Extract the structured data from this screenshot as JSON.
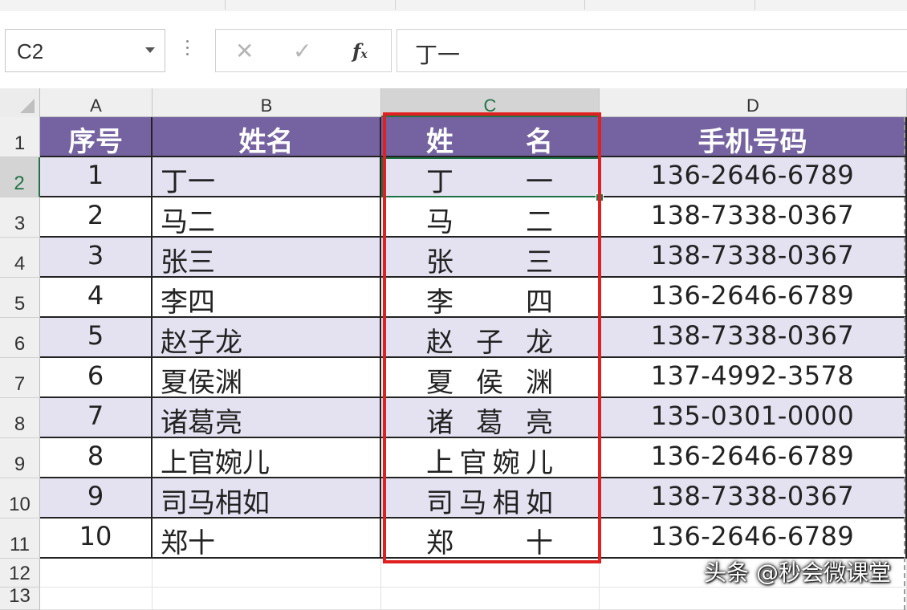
{
  "name_box": {
    "value": "C2"
  },
  "formula_bar": {
    "cancel_icon": "cancel-x-icon",
    "enter_icon": "checkmark-icon",
    "fx_label": "f",
    "fx_sub": "x",
    "value": "丁一"
  },
  "columns": [
    "A",
    "B",
    "C",
    "D"
  ],
  "rows": [
    "1",
    "2",
    "3",
    "4",
    "5",
    "6",
    "7",
    "8",
    "9",
    "10",
    "11",
    "12",
    "13"
  ],
  "table": {
    "headers": {
      "seq": "序号",
      "name": "姓名",
      "name_dist": [
        "姓",
        "名"
      ],
      "phone": "手机号码"
    },
    "records": [
      {
        "seq": "1",
        "name": "丁一",
        "dist": [
          "丁",
          "一"
        ],
        "phone": "136-2646-6789"
      },
      {
        "seq": "2",
        "name": "马二",
        "dist": [
          "马",
          "二"
        ],
        "phone": "138-7338-0367"
      },
      {
        "seq": "3",
        "name": "张三",
        "dist": [
          "张",
          "三"
        ],
        "phone": "138-7338-0367"
      },
      {
        "seq": "4",
        "name": "李四",
        "dist": [
          "李",
          "四"
        ],
        "phone": "136-2646-6789"
      },
      {
        "seq": "5",
        "name": "赵子龙",
        "dist": [
          "赵",
          "子",
          "龙"
        ],
        "phone": "138-7338-0367"
      },
      {
        "seq": "6",
        "name": "夏侯渊",
        "dist": [
          "夏",
          "侯",
          "渊"
        ],
        "phone": "137-4992-3578"
      },
      {
        "seq": "7",
        "name": "诸葛亮",
        "dist": [
          "诸",
          "葛",
          "亮"
        ],
        "phone": "135-0301-0000"
      },
      {
        "seq": "8",
        "name": "上官婉儿",
        "dist": [
          "上",
          "官",
          "婉",
          "儿"
        ],
        "phone": "136-2646-6789"
      },
      {
        "seq": "9",
        "name": "司马相如",
        "dist": [
          "司",
          "马",
          "相",
          "如"
        ],
        "phone": "138-7338-0367"
      },
      {
        "seq": "10",
        "name": "郑十",
        "dist": [
          "郑",
          "十"
        ],
        "phone": "136-2646-6789"
      }
    ]
  },
  "colors": {
    "header_fill": "#7562a0",
    "band_fill": "#e4e2f0",
    "highlight_border": "#e02020",
    "selection": "#1e7145"
  },
  "watermark": "头条 @秒会微课堂"
}
